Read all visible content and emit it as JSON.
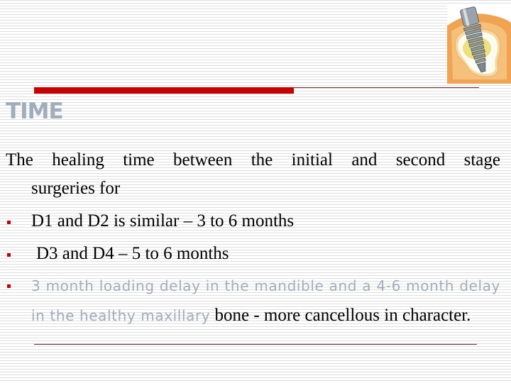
{
  "colors": {
    "accent": "#c80000",
    "accent_line": "#8b1a1a",
    "title": "#a0aebb",
    "muted_text": "#a0aebb",
    "body_text": "#000000",
    "footer_line": "#6b2a2a"
  },
  "header": {
    "image_icon": "dental-implant-illustration"
  },
  "slide": {
    "title": "TIME",
    "intro_line1": "The healing time between the initial and second stage",
    "intro_line2": "surgeries for",
    "bullets": [
      {
        "text": "D1 and D2 is similar – 3 to 6 months"
      },
      {
        "text": "D3 and D4 – 5 to 6 months"
      },
      {
        "muted_text": "3 month loading delay in the mandible and a 4-6 month delay in the healthy maxillary",
        "text": " bone - more cancellous in character."
      }
    ]
  }
}
